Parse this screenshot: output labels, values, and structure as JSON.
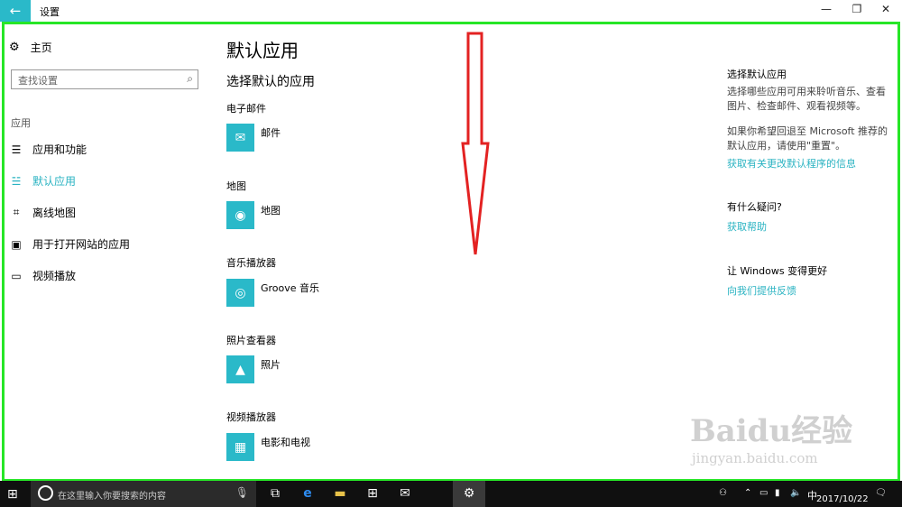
{
  "window": {
    "title": "设置",
    "back_icon": "back-arrow-icon"
  },
  "sidebar": {
    "home_label": "主页",
    "search_placeholder": "查找设置",
    "section_label": "应用",
    "items": [
      {
        "label": "应用和功能",
        "icon": "list-icon"
      },
      {
        "label": "默认应用",
        "icon": "default-list-icon",
        "active": true
      },
      {
        "label": "离线地图",
        "icon": "map-icon"
      },
      {
        "label": "用于打开网站的应用",
        "icon": "website-icon"
      },
      {
        "label": "视频播放",
        "icon": "video-icon"
      }
    ]
  },
  "main": {
    "title": "默认应用",
    "subtitle": "选择默认的应用",
    "categories": [
      {
        "label": "电子邮件",
        "app": "邮件"
      },
      {
        "label": "地图",
        "app": "地图"
      },
      {
        "label": "音乐播放器",
        "app": "Groove 音乐"
      },
      {
        "label": "照片查看器",
        "app": "照片"
      },
      {
        "label": "视频播放器",
        "app": "电影和电视"
      }
    ]
  },
  "right": {
    "section1_title": "选择默认应用",
    "section1_text1": "选择哪些应用可用来聆听音乐、查看图片、检查邮件、观看视频等。",
    "section1_text2": "如果你希望回退至 Microsoft 推荐的默认应用，请使用\"重置\"。",
    "section1_link": "获取有关更改默认程序的信息",
    "section2_title": "有什么疑问?",
    "section2_link": "获取帮助",
    "section3_title": "让 Windows 变得更好",
    "section3_link": "向我们提供反馈"
  },
  "taskbar": {
    "search_placeholder": "在这里输入你要搜索的内容",
    "ime": "中",
    "date": "2017/10/22"
  },
  "watermark": {
    "logo_text": "Baidu经验",
    "url": "jingyan.baidu.com"
  },
  "colors": {
    "accent": "#2ab9c9",
    "frame": "#27e627",
    "arrow": "#e32222"
  }
}
